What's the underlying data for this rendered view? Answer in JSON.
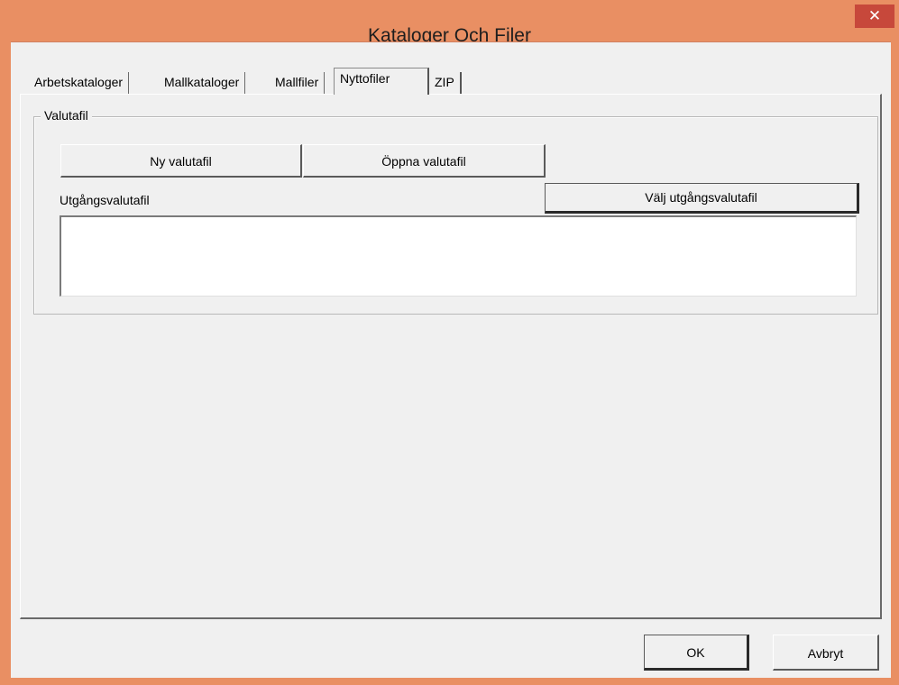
{
  "window": {
    "title": "Kataloger Och Filer",
    "close_glyph": "✕"
  },
  "tabs": [
    {
      "label": "Arbetskataloger",
      "active": false
    },
    {
      "label": "Mallkataloger",
      "active": false
    },
    {
      "label": "Mallfiler",
      "active": false
    },
    {
      "label": "Nyttofiler",
      "active": true
    },
    {
      "label": "ZIP",
      "active": false
    }
  ],
  "groupbox": {
    "legend": "Valutafil",
    "new_button": "Ny valutafil",
    "open_button": "Öppna valutafil",
    "output_label": "Utgångsvalutafil",
    "choose_button": "Välj utgångsvalutafil",
    "output_value": ""
  },
  "footer": {
    "ok_label": "OK",
    "cancel_label": "Avbryt"
  },
  "colors": {
    "titlebar": "#e98f63",
    "close_button": "#c7483b",
    "dialog_background": "#f0f0f0"
  }
}
